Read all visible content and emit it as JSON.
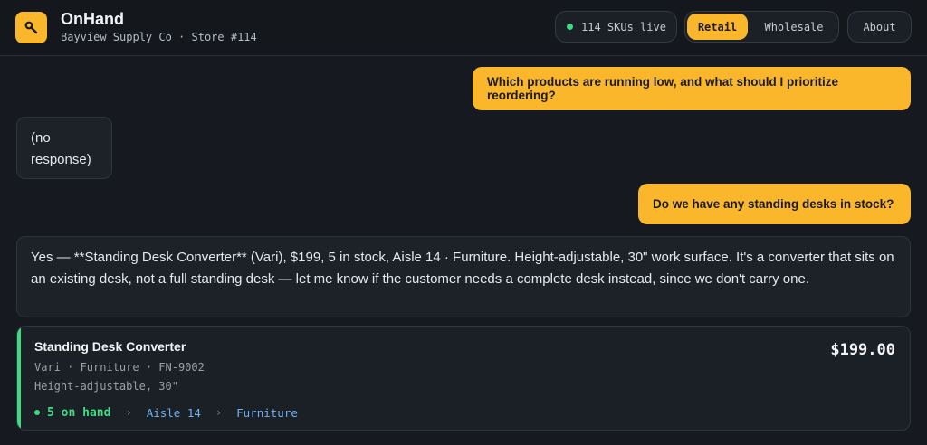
{
  "header": {
    "app_title": "OnHand",
    "subtitle": "Bayview Supply Co · Store #114",
    "skus_label": "114 SKUs live",
    "modes": [
      "Retail",
      "Wholesale"
    ],
    "active_mode": "Retail",
    "about_label": "About"
  },
  "colors": {
    "accent": "#fbb72b",
    "success": "#3ddc84",
    "link": "#6fb2f0",
    "background": "#16191f"
  },
  "chat": {
    "messages": [
      {
        "role": "user",
        "text": "Which products are running low, and what should I prioritize reordering?"
      },
      {
        "role": "assistant",
        "text": "(no response)"
      },
      {
        "role": "user",
        "text": "Do we have any standing desks in stock?"
      },
      {
        "role": "assistant",
        "text": "Yes — **Standing Desk Converter** (Vari), $199, 5 in stock, Aisle 14 · Furniture. Height-adjustable, 30\" work surface. It's a converter that sits on an existing desk, not a full standing desk — let me know if the customer needs a complete desk instead, since we don't carry one."
      }
    ]
  },
  "product_card": {
    "name": "Standing Desk Converter",
    "meta": "Vari · Furniture · FN-9002",
    "description": "Height-adjustable, 30\"",
    "price": "$199.00",
    "stock_label": "5 on hand",
    "aisle": "Aisle 14",
    "category": "Furniture"
  },
  "icons": {
    "logo": "barcode-scanner-icon",
    "status": "status-dot-icon",
    "separator": "chevron-right-icon"
  }
}
